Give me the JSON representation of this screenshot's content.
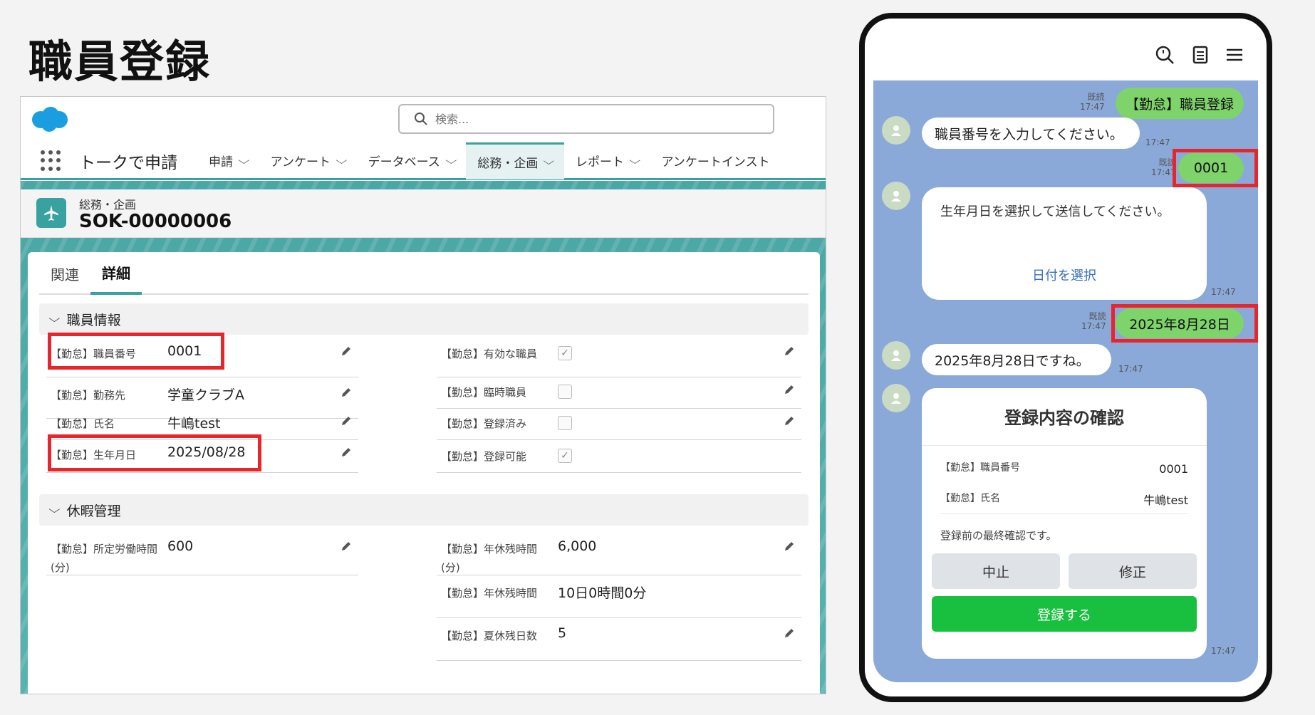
{
  "page_title": "職員登録",
  "salesforce": {
    "search_placeholder": "検索...",
    "app_name": "トークで申請",
    "nav": [
      {
        "label": "申請"
      },
      {
        "label": "アンケート"
      },
      {
        "label": "データベース"
      },
      {
        "label": "総務・企画",
        "active": true
      },
      {
        "label": "レポート"
      },
      {
        "label": "アンケートインスト"
      }
    ],
    "record": {
      "type": "総務・企画",
      "name": "SOK-00000006"
    },
    "tabs": [
      {
        "label": "関連"
      },
      {
        "label": "詳細",
        "active": true
      }
    ],
    "sections": [
      {
        "title": "職員情報",
        "left": [
          {
            "label": "【勤怠】職員番号",
            "value": "0001",
            "highlighted": true
          },
          {
            "label": "【勤怠】勤務先",
            "value": "学童クラブA"
          },
          {
            "label": "【勤怠】氏名",
            "value": "牛嶋test"
          },
          {
            "label": "【勤怠】生年月日",
            "value": "2025/08/28",
            "highlighted": true
          }
        ],
        "right": [
          {
            "label": "【勤怠】有効な職員",
            "checked": true
          },
          {
            "label": "【勤怠】臨時職員",
            "checked": false
          },
          {
            "label": "【勤怠】登録済み",
            "checked": false
          },
          {
            "label": "【勤怠】登録可能",
            "checked": true
          }
        ]
      },
      {
        "title": "休暇管理",
        "left": [
          {
            "label": "【勤怠】所定労働時間(分)",
            "value": "600"
          }
        ],
        "right": [
          {
            "label": "【勤怠】年休残時間(分)",
            "value": "6,000"
          },
          {
            "label": "【勤怠】年休残時間",
            "value": "10日0時間0分"
          },
          {
            "label": "【勤怠】夏休残日数",
            "value": "5"
          }
        ]
      }
    ]
  },
  "chat": {
    "messages": [
      {
        "side": "right",
        "text": "【勤怠】職員登録",
        "read": "既読",
        "time": "17:47"
      },
      {
        "side": "left",
        "text": "職員番号を入力してください。",
        "time": "17:47"
      },
      {
        "side": "right",
        "text": "0001",
        "read": "既読",
        "time": "17:47",
        "highlighted": true
      },
      {
        "side": "left",
        "text": "生年月日を選択して送信してください。",
        "link": "日付を選択",
        "time": "17:47"
      },
      {
        "side": "right",
        "text": "2025年8月28日",
        "read": "既読",
        "time": "17:47",
        "highlighted": true
      },
      {
        "side": "left",
        "text": "2025年8月28日ですね。",
        "time": "17:47"
      }
    ],
    "confirm": {
      "title": "登録内容の確認",
      "rows": [
        {
          "label": "【勤怠】職員番号",
          "value": "0001"
        },
        {
          "label": "【勤怠】氏名",
          "value": "牛嶋test"
        }
      ],
      "note": "登録前の最終確認です。",
      "cancel": "中止",
      "edit": "修正",
      "register": "登録する",
      "time": "17:47"
    }
  },
  "colors": {
    "accent_teal": "#3aa1a1",
    "line_green": "#7ed36a",
    "register_green": "#19bf3f",
    "highlight_red": "#e8252a",
    "chat_bg": "#8aa9d8"
  }
}
